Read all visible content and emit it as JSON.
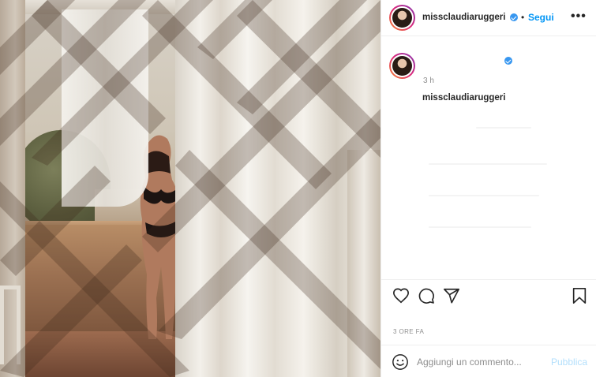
{
  "post": {
    "photo": {
      "alt_icon": "post-photo"
    },
    "header": {
      "username": "missclaudiaruggeri",
      "verified_icon": "verified-badge-icon",
      "separator": "•",
      "follow_label": "Segui",
      "more_label": "•••"
    },
    "caption": {
      "username": "missclaudiaruggeri",
      "verified_icon": "verified-badge-icon",
      "time_ago": "3 h"
    },
    "actions": {
      "like_icon": "heart-icon",
      "comment_icon": "comment-bubble-icon",
      "share_icon": "paper-plane-icon",
      "save_icon": "bookmark-icon"
    },
    "date_label": "3 ORE FA",
    "comment_box": {
      "emoji_icon": "smiley-icon",
      "placeholder": "Aggiungi un commento...",
      "publish_label": "Pubblica"
    }
  },
  "colors": {
    "accent": "#0095f6",
    "verified": "#3897f0",
    "publish_disabled": "#b2dffc",
    "muted_text": "#8e8e8e",
    "border": "#efefef"
  }
}
